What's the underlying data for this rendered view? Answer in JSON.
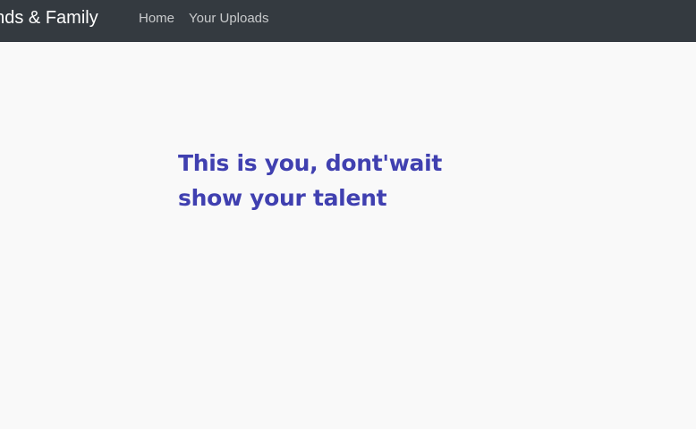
{
  "navbar": {
    "brand": "ends & Family",
    "links": [
      {
        "label": "Home"
      },
      {
        "label": "Your Uploads"
      }
    ]
  },
  "hero": {
    "line1": "This is you, dont'wait",
    "line2": "show your talent"
  },
  "colors": {
    "navbar_bg": "#343a40",
    "page_bg": "#f9f9f9",
    "accent_text": "#4040b0"
  }
}
